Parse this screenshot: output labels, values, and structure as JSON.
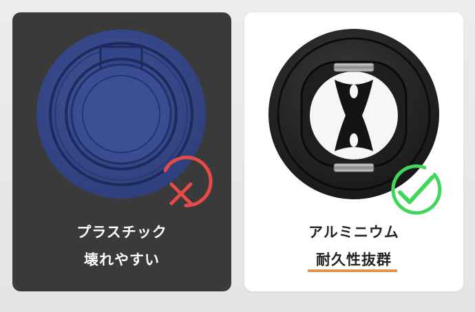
{
  "comparison": {
    "left": {
      "material": "プラスチック",
      "verdict": "壊れやすい",
      "status_icon": "cross-icon",
      "status_color": "#e84a4a",
      "ring_color": "#364a8c",
      "card_color": "#3a3a3a"
    },
    "right": {
      "material": "アルミニウム",
      "verdict": "耐久性抜群",
      "status_icon": "check-icon",
      "status_color": "#3fd65a",
      "ring_color": "#1c1c1c",
      "card_color": "#ffffff",
      "underline_color": "#e2964a"
    }
  }
}
